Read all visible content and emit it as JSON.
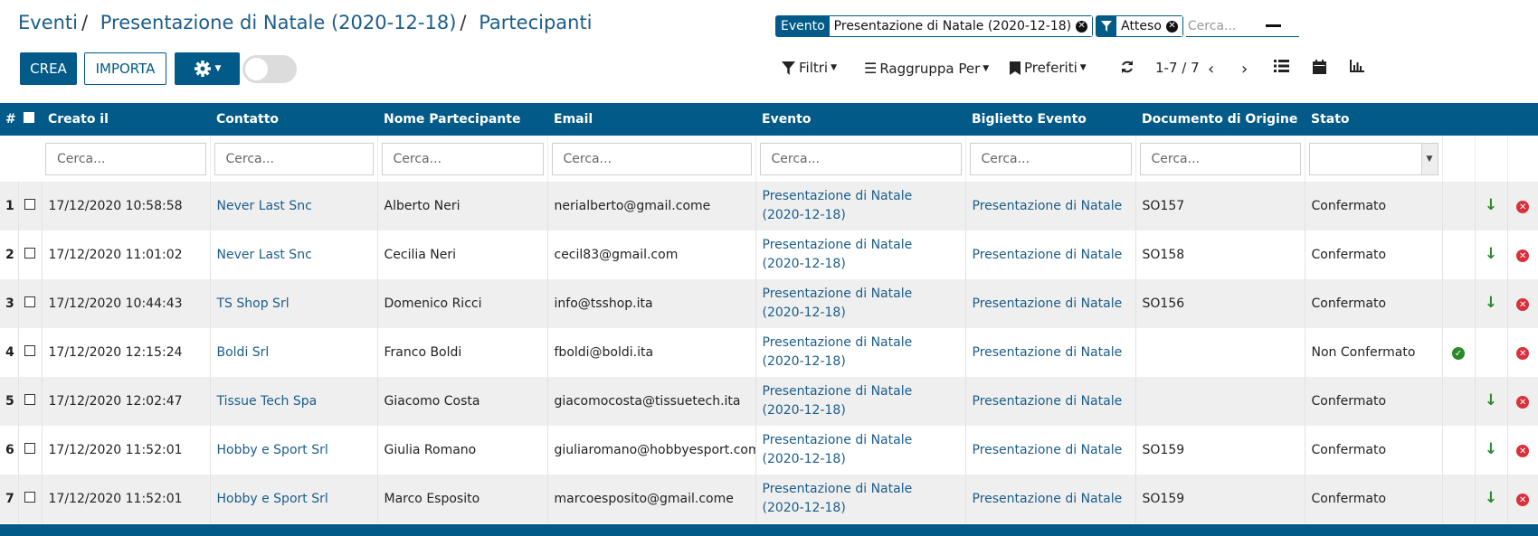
{
  "breadcrumb": {
    "items": [
      "Eventi",
      "Presentazione di Natale (2020-12-18)",
      "Partecipanti"
    ]
  },
  "buttons": {
    "create": "CREA",
    "import": "IMPORTA"
  },
  "facets": [
    {
      "label": "Evento",
      "value": "Presentazione di Natale (2020-12-18)"
    },
    {
      "label": "",
      "value": "Atteso"
    }
  ],
  "search": {
    "placeholder": "Cerca..."
  },
  "controls": {
    "filters": "Filtri",
    "group_by": "Raggruppa Per",
    "favorites": "Preferiti",
    "pager": "1-7 / 7"
  },
  "table": {
    "columns": {
      "num": "#",
      "created": "Creato il",
      "contact": "Contatto",
      "name": "Nome Partecipante",
      "email": "Email",
      "event": "Evento",
      "ticket": "Biglietto Evento",
      "origin": "Documento di Origine",
      "status": "Stato"
    },
    "filter_placeholder": "Cerca...",
    "rows": [
      {
        "num": "1",
        "created": "17/12/2020 10:58:58",
        "contact": "Never Last Snc",
        "name": "Alberto Neri",
        "email": "nerialberto@gmail.come",
        "event_line1": "Presentazione di Natale",
        "event_line2": "(2020-12-18)",
        "ticket": "Presentazione di Natale",
        "origin": "SO157",
        "status": "Confermato",
        "action": "down"
      },
      {
        "num": "2",
        "created": "17/12/2020 11:01:02",
        "contact": "Never Last Snc",
        "name": "Cecilia Neri",
        "email": "cecil83@gmail.com",
        "event_line1": "Presentazione di Natale",
        "event_line2": "(2020-12-18)",
        "ticket": "Presentazione di Natale",
        "origin": "SO158",
        "status": "Confermato",
        "action": "down"
      },
      {
        "num": "3",
        "created": "17/12/2020 10:44:43",
        "contact": "TS Shop Srl",
        "name": "Domenico Ricci",
        "email": "info@tsshop.ita",
        "event_line1": "Presentazione di Natale",
        "event_line2": "(2020-12-18)",
        "ticket": "Presentazione di Natale",
        "origin": "SO156",
        "status": "Confermato",
        "action": "down"
      },
      {
        "num": "4",
        "created": "17/12/2020 12:15:24",
        "contact": "Boldi Srl",
        "name": "Franco Boldi",
        "email": "fboldi@boldi.ita",
        "event_line1": "Presentazione di Natale",
        "event_line2": "(2020-12-18)",
        "ticket": "Presentazione di Natale",
        "origin": "",
        "status": "Non Confermato",
        "action": "check"
      },
      {
        "num": "5",
        "created": "17/12/2020 12:02:47",
        "contact": "Tissue Tech Spa",
        "name": "Giacomo Costa",
        "email": "giacomocosta@tissuetech.ita",
        "event_line1": "Presentazione di Natale",
        "event_line2": "(2020-12-18)",
        "ticket": "Presentazione di Natale",
        "origin": "",
        "status": "Confermato",
        "action": "down"
      },
      {
        "num": "6",
        "created": "17/12/2020 11:52:01",
        "contact": "Hobby e Sport Srl",
        "name": "Giulia Romano",
        "email": "giuliaromano@hobbyesport.come",
        "event_line1": "Presentazione di Natale",
        "event_line2": "(2020-12-18)",
        "ticket": "Presentazione di Natale",
        "origin": "SO159",
        "status": "Confermato",
        "action": "down"
      },
      {
        "num": "7",
        "created": "17/12/2020 11:52:01",
        "contact": "Hobby e Sport Srl",
        "name": "Marco Esposito",
        "email": "marcoesposito@gmail.come",
        "event_line1": "Presentazione di Natale",
        "event_line2": "(2020-12-18)",
        "ticket": "Presentazione di Natale",
        "origin": "SO159",
        "status": "Confermato",
        "action": "down"
      }
    ]
  },
  "colors": {
    "primary": "#015a87",
    "link": "#1b5d8b",
    "success": "#2a8a2a",
    "danger": "#d9303c"
  }
}
